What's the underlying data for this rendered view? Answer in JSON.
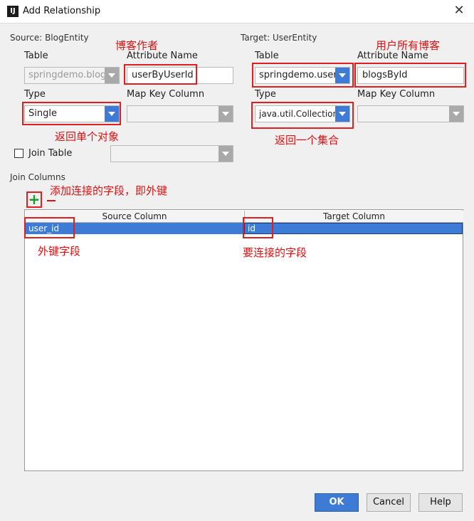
{
  "window": {
    "title": "Add Relationship",
    "app_icon": "IJ"
  },
  "source": {
    "section_label": "Source: BlogEntity",
    "table_label": "Table",
    "table_value": "springdemo.blog",
    "attribute_label": "Attribute Name",
    "attribute_value": "userByUserId",
    "type_label": "Type",
    "type_value": "Single",
    "mapkey_label": "Map Key Column",
    "mapkey_value": "",
    "join_table_label": "Join Table"
  },
  "target": {
    "section_label": "Target: UserEntity",
    "table_label": "Table",
    "table_value": "springdemo.user",
    "attribute_label": "Attribute Name",
    "attribute_value": "blogsById",
    "type_label": "Type",
    "type_value": "java.util.Collection",
    "mapkey_label": "Map Key Column",
    "mapkey_value": ""
  },
  "annotations": {
    "blog_author": "博客作者",
    "user_blogs": "用户所有博客",
    "return_single": "返回单个对象",
    "return_collection": "返回一个集合",
    "add_join_field": "添加连接的字段，即外键",
    "foreign_key_field": "外键字段",
    "field_to_join": "要连接的字段"
  },
  "join_columns": {
    "section_label": "Join Columns",
    "add_icon": "plus-icon",
    "remove_icon": "minus-icon",
    "headers": [
      "Source Column",
      "Target Column"
    ],
    "rows": [
      {
        "source": "user_id",
        "target": "id"
      }
    ]
  },
  "buttons": {
    "ok": "OK",
    "cancel": "Cancel",
    "help": "Help"
  },
  "colors": {
    "accent": "#3d7bd6",
    "annotation": "#e01010",
    "add_green": "#1a9a2a"
  }
}
